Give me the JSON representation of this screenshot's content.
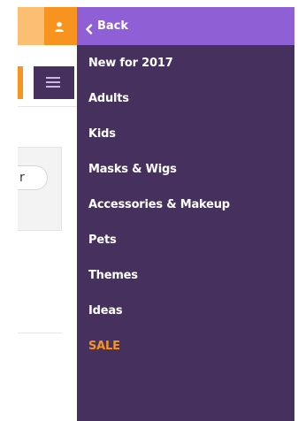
{
  "header": {
    "user_icon": "user-icon",
    "menu_icon": "hamburger-icon"
  },
  "search": {
    "placeholder_partial": "r"
  },
  "drawer": {
    "back_icon": "chevron-left-icon",
    "back_label": "Back",
    "items": [
      {
        "label": "New for 2017"
      },
      {
        "label": "Adults"
      },
      {
        "label": "Kids"
      },
      {
        "label": "Masks & Wigs"
      },
      {
        "label": "Accessories & Makeup"
      },
      {
        "label": "Pets"
      },
      {
        "label": "Themes"
      },
      {
        "label": "Ideas"
      },
      {
        "label": "SALE"
      }
    ]
  },
  "colors": {
    "brand_orange": "#f7931e",
    "light_orange": "#fbbe73",
    "drawer_purple": "#45305e",
    "header_purple": "#8f5fd6",
    "sale_orange": "#f7931e"
  }
}
